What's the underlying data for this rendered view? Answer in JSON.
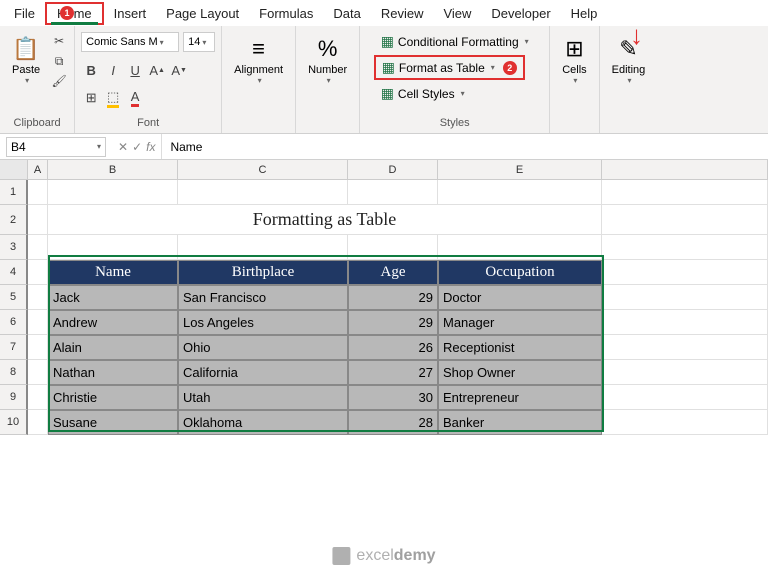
{
  "menu": {
    "file": "File",
    "home": "Home",
    "insert": "Insert",
    "page_layout": "Page Layout",
    "formulas": "Formulas",
    "data": "Data",
    "review": "Review",
    "view": "View",
    "developer": "Developer",
    "help": "Help"
  },
  "callouts": {
    "c1": "1",
    "c2": "2",
    "arrow": "↓"
  },
  "ribbon": {
    "clipboard": {
      "label": "Clipboard",
      "paste": "Paste"
    },
    "font": {
      "label": "Font",
      "font_name": "Comic Sans M",
      "font_size": "14",
      "bold": "B",
      "italic": "I",
      "underline": "U"
    },
    "alignment": {
      "label": "Alignment",
      "btn": "Alignment"
    },
    "number": {
      "label": "Number",
      "btn": "Number"
    },
    "styles": {
      "label": "Styles",
      "cond_fmt": "Conditional Formatting",
      "fmt_table": "Format as Table",
      "cell_styles": "Cell Styles"
    },
    "cells": {
      "label": "Cells",
      "btn": "Cells"
    },
    "editing": {
      "label": "Editing",
      "btn": "Editing"
    }
  },
  "formula_bar": {
    "name_box": "B4",
    "fx": "fx",
    "value": "Name"
  },
  "columns": {
    "A": "A",
    "B": "B",
    "C": "C",
    "D": "D",
    "E": "E",
    "F": ""
  },
  "row_nums": [
    "1",
    "2",
    "3",
    "4",
    "5",
    "6",
    "7",
    "8",
    "9",
    "10"
  ],
  "sheet": {
    "title": "Formatting as Table",
    "headers": {
      "name": "Name",
      "birthplace": "Birthplace",
      "age": "Age",
      "occupation": "Occupation"
    },
    "rows": [
      {
        "name": "Jack",
        "birthplace": "San Francisco",
        "age": "29",
        "occupation": "Doctor"
      },
      {
        "name": "Andrew",
        "birthplace": "Los Angeles",
        "age": "29",
        "occupation": "Manager"
      },
      {
        "name": "Alain",
        "birthplace": "Ohio",
        "age": "26",
        "occupation": "Receptionist"
      },
      {
        "name": "Nathan",
        "birthplace": "California",
        "age": "27",
        "occupation": "Shop Owner"
      },
      {
        "name": "Christie",
        "birthplace": "Utah",
        "age": "30",
        "occupation": "Entrepreneur"
      },
      {
        "name": "Susane",
        "birthplace": "Oklahoma",
        "age": "28",
        "occupation": "Banker"
      }
    ]
  },
  "watermark": {
    "text1": "excel",
    "text2": "demy"
  }
}
